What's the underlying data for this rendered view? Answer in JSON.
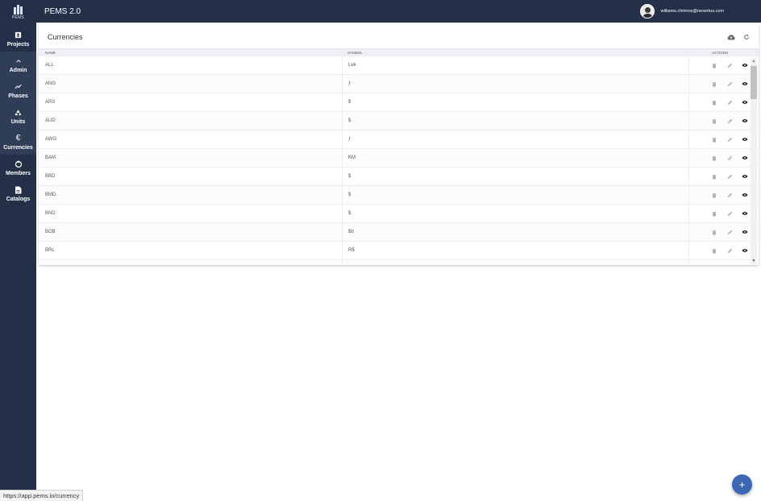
{
  "app": {
    "logo_text": "PEMS",
    "title": "PEMS 2.0"
  },
  "user": {
    "email": "williams.chirinos@nexertus.com"
  },
  "sidebar": {
    "items": [
      {
        "label": "Projects",
        "icon": "projects-icon"
      },
      {
        "label": "Admin",
        "icon": "chevron-up-icon"
      },
      {
        "label": "Phases",
        "icon": "trending-icon"
      },
      {
        "label": "Units",
        "icon": "units-icon"
      },
      {
        "label": "Currencies",
        "icon": "euro-icon"
      },
      {
        "label": "Members",
        "icon": "members-icon"
      },
      {
        "label": "Catalogs",
        "icon": "document-icon"
      }
    ]
  },
  "page": {
    "title": "Currencies",
    "columns": {
      "name": "NAME",
      "symbol": "SYMBOL",
      "actions": "ACTIONS"
    },
    "rows": [
      {
        "name": "ALL",
        "symbol": "Lek"
      },
      {
        "name": "ANG",
        "symbol": "ƒ"
      },
      {
        "name": "ARS",
        "symbol": "$"
      },
      {
        "name": "AUD",
        "symbol": "$"
      },
      {
        "name": "AWG",
        "symbol": "ƒ"
      },
      {
        "name": "BAM",
        "symbol": "KM"
      },
      {
        "name": "BBD",
        "symbol": "$"
      },
      {
        "name": "BMD",
        "symbol": "$"
      },
      {
        "name": "BND",
        "symbol": "$"
      },
      {
        "name": "BOB",
        "symbol": "$b"
      },
      {
        "name": "BRL",
        "symbol": "R$"
      }
    ]
  },
  "status_bar": {
    "url": "https://app.pems.io/currency"
  },
  "fab": {
    "label": "+"
  },
  "colors": {
    "sidebar": "#233047",
    "accent": "#3b67b5"
  }
}
